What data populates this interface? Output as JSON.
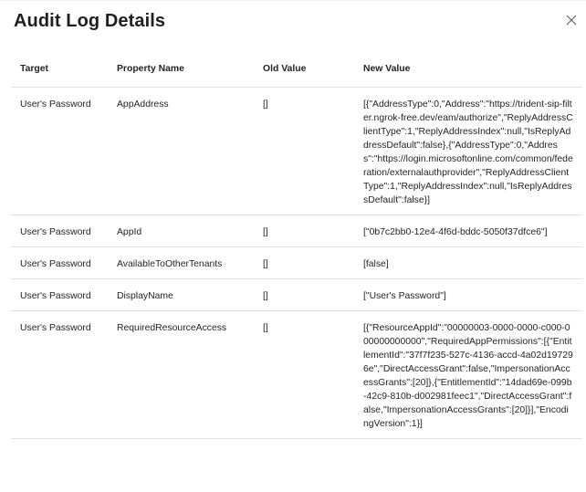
{
  "dialog": {
    "title": "Audit Log Details",
    "close_icon": "close-icon"
  },
  "table": {
    "headers": [
      "Target",
      "Property Name",
      "Old Value",
      "New Value"
    ],
    "rows": [
      {
        "target": "User's Password",
        "property": "AppAddress",
        "old": "[]",
        "new": "[{\"AddressType\":0,\"Address\":\"https://trident-sip-filter.ngrok-free.dev/eam/authorize\",\"ReplyAddressClientType\":1,\"ReplyAddressIndex\":null,\"IsReplyAddressDefault\":false},{\"AddressType\":0,\"Address\":\"https://login.microsoftonline.com/common/federation/externalauthprovider\",\"ReplyAddressClientType\":1,\"ReplyAddressIndex\":null,\"IsReplyAddressDefault\":false}]"
      },
      {
        "target": "User's Password",
        "property": "AppId",
        "old": "[]",
        "new": "[\"0b7c2bb0-12e4-4f6d-bddc-5050f37dfce6\"]"
      },
      {
        "target": "User's Password",
        "property": "AvailableToOtherTenants",
        "old": "[]",
        "new": "[false]"
      },
      {
        "target": "User's Password",
        "property": "DisplayName",
        "old": "[]",
        "new": "[\"User's Password\"]"
      },
      {
        "target": "User's Password",
        "property": "RequiredResourceAccess",
        "old": "[]",
        "new": "[{\"ResourceAppId\":\"00000003-0000-0000-c000-000000000000\",\"RequiredAppPermissions\":[{\"EntitlementId\":\"37f7f235-527c-4136-accd-4a02d197296e\",\"DirectAccessGrant\":false,\"ImpersonationAccessGrants\":[20]},{\"EntitlementId\":\"14dad69e-099b-42c9-810b-d002981feec1\",\"DirectAccessGrant\":false,\"ImpersonationAccessGrants\":[20]}],\"EncodingVersion\":1}]"
      }
    ]
  }
}
